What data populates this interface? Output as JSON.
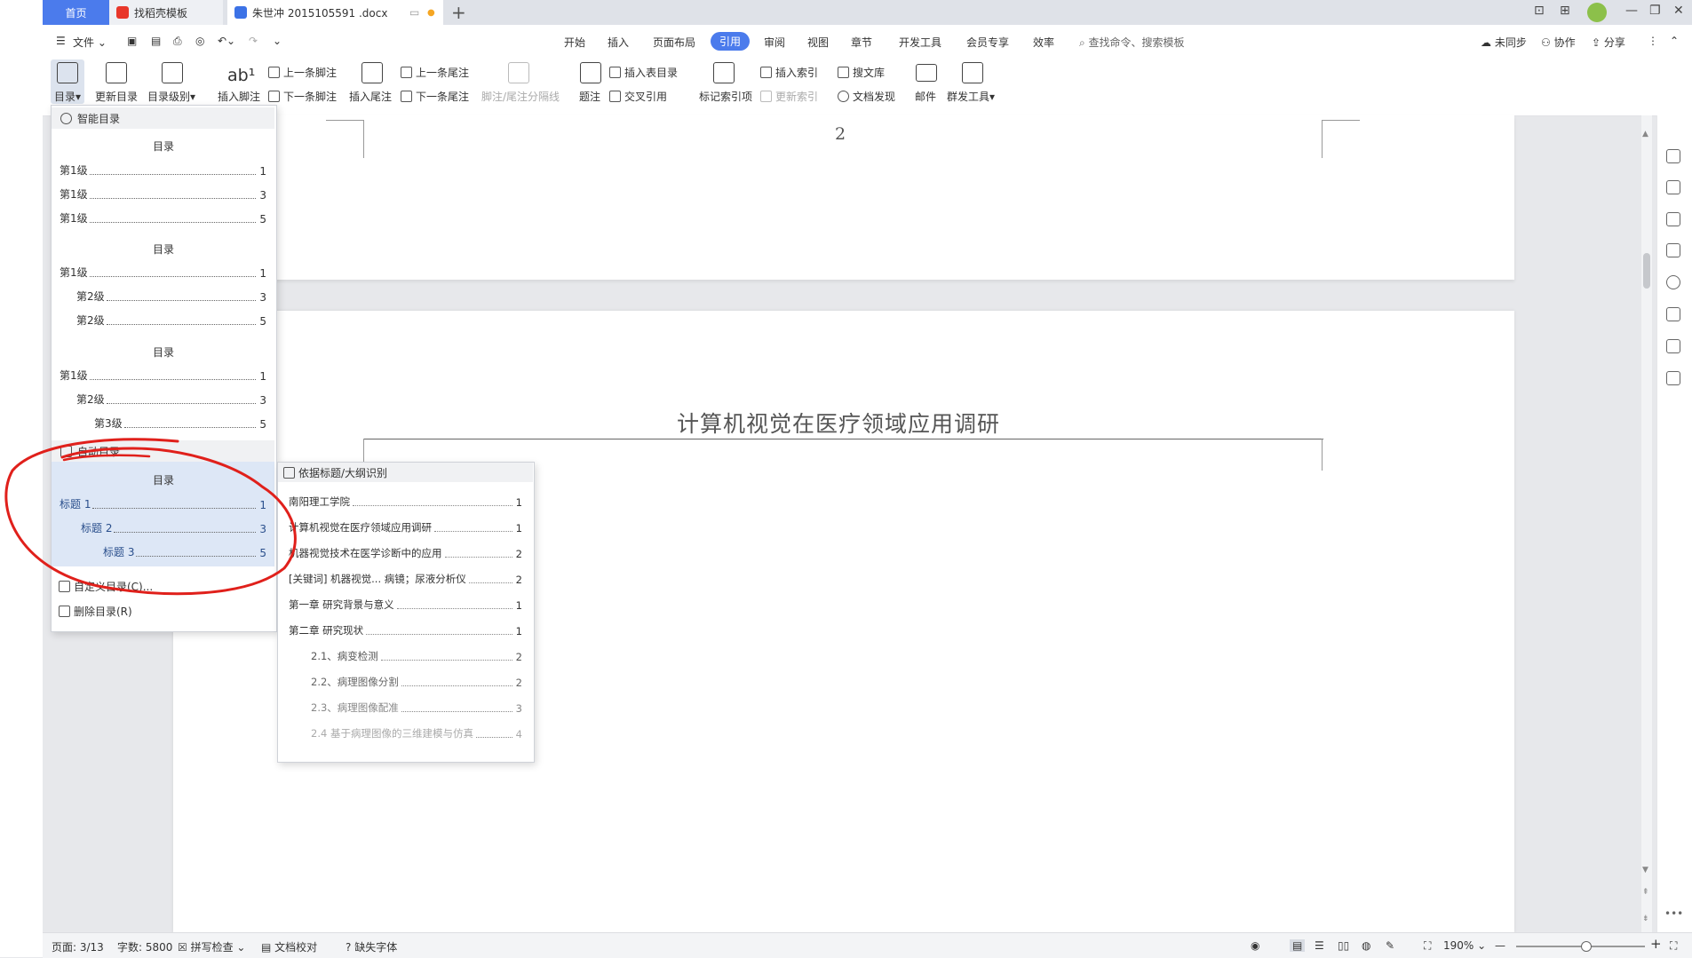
{
  "tabs": {
    "home": "首页",
    "template": "找稻壳模板",
    "doc": "朱世冲 2015105591 .docx"
  },
  "menu": {
    "file": "文件",
    "items": [
      "开始",
      "插入",
      "页面布局",
      "引用",
      "审阅",
      "视图",
      "章节",
      "开发工具",
      "会员专享",
      "效率"
    ],
    "search": "查找命令、搜索模板",
    "sync": "未同步",
    "collab": "协作",
    "share": "分享"
  },
  "ribbon": {
    "toc": "目录",
    "update_toc": "更新目录",
    "toc_level": "目录级别",
    "insert_footnote": "插入脚注",
    "prev_footnote": "上一条脚注",
    "next_footnote": "下一条脚注",
    "insert_endnote": "插入尾注",
    "prev_endnote": "上一条尾注",
    "next_endnote": "下一条尾注",
    "footnote_sep": "脚注/尾注分隔线",
    "caption": "题注",
    "insert_table_of_figures": "插入表目录",
    "cross_ref": "交叉引用",
    "mark_index": "标记索引项",
    "insert_index": "插入索引",
    "update_index": "更新索引",
    "search_lib": "搜文库",
    "doc_discover": "文档发现",
    "mail": "邮件",
    "mass_tools": "群发工具"
  },
  "toc_gallery": {
    "smart_header": "智能目录",
    "auto_header": "自动目录",
    "title": "目录",
    "smart1": [
      [
        "第1级",
        "1"
      ],
      [
        "第1级",
        "3"
      ],
      [
        "第1级",
        "5"
      ]
    ],
    "smart2": [
      [
        "第1级",
        "1"
      ],
      [
        "第2级",
        "3"
      ],
      [
        "第2级",
        "5"
      ]
    ],
    "smart3": [
      [
        "第1级",
        "1"
      ],
      [
        "第2级",
        "3"
      ],
      [
        "第3级",
        "5"
      ]
    ],
    "auto": [
      [
        "标题 1",
        "1"
      ],
      [
        "标题 2",
        "3"
      ],
      [
        "标题 3",
        "5"
      ]
    ],
    "custom": "自定义目录(C)...",
    "delete": "删除目录(R)"
  },
  "preview": {
    "header": "依据标题/大纲识别",
    "rows": [
      [
        "南阳理工学院",
        "1"
      ],
      [
        "计算机视觉在医疗领域应用调研",
        "1"
      ],
      [
        "机器视觉技术在医学诊断中的应用",
        "2"
      ],
      [
        "[关键词] 机器视觉... 病镜；尿液分析仪",
        "2"
      ],
      [
        "第一章 研究背景与意义",
        "1"
      ],
      [
        "第二章 研究现状",
        "1"
      ],
      [
        "2.1、病变检测",
        "2"
      ],
      [
        "2.2、病理图像分割",
        "2"
      ],
      [
        "2.3、病理图像配准",
        "3"
      ],
      [
        "2.4 基于病理图像的三维建模与仿真",
        "4"
      ]
    ]
  },
  "document": {
    "page_number": "2",
    "title": "计算机视觉在医疗领域应用调研"
  },
  "status": {
    "page": "页面: 3/13",
    "words": "字数: 5800",
    "spell": "拼写检查",
    "proof": "文档校对",
    "missing_font": "缺失字体",
    "zoom": "190%"
  },
  "colors": {
    "accent": "#4b7bec",
    "annotation": "#e0201b"
  }
}
